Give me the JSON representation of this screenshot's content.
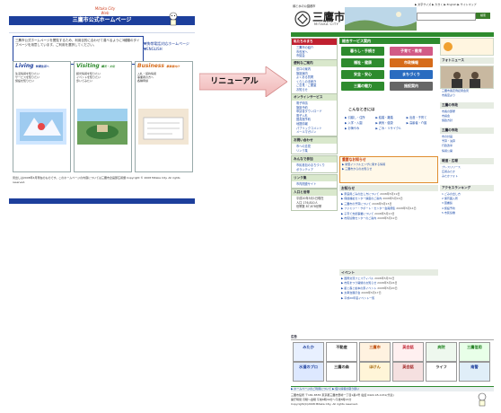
{
  "old_page": {
    "logo": "Mitaka City Web",
    "title": "三鷹市公式ホームページ",
    "intro": "三鷹市公式ホームページを閲覧するため、利用目的に合わせて達べるように3種類のタイプページを用意しています。ご利用を選択してください。",
    "links": [
      "▼携帯電話対応ホームページ",
      "▼ENGLISH"
    ],
    "columns": [
      {
        "title": "Living",
        "sub": "快適生活へ",
        "color": "#1d3f9c",
        "items": [
          "生活情報を知りたい",
          "サービスを知りたい",
          "施設を知りたい"
        ]
      },
      {
        "title": "Visiting",
        "sub": "観光・文化",
        "color": "#2e8b2e",
        "items": [
          "観光情報を知りたい",
          "イベントを知りたい",
          "歩いてみたい"
        ]
      },
      {
        "title": "Business",
        "sub": "事業者向け",
        "color": "#d66b1a",
        "items": [
          "入札・契約情報",
          "事業者の方へ",
          "各種申請"
        ]
      }
    ],
    "footer": "見出しは2008年4月現在のものです。このホームページの内容については三鷹市企画部広報課  Copyright © 2008 Mitaka City. All rights reserved."
  },
  "arrow": {
    "label": "リニューアル"
  },
  "new_page": {
    "tagline": "緑と水の公園都市",
    "city_name": "三鷹市",
    "city_en": "MITAKA CITY",
    "top_nav": "▶ 文字サイズ  ▶ 大きく  ▶ English  ▶ サイトマップ",
    "search_button": "検索",
    "left_boxes": [
      {
        "title": "私たちのまち",
        "style": "red",
        "items": [
          "三鷹市の紹介",
          "市長室へ",
          "市議会"
        ]
      },
      {
        "title": "便利なご案内",
        "style": "green",
        "items": [
          "窓口の案内",
          "施設案内",
          "よくある質問",
          "くらしの手続き",
          "ご意見・ご要望",
          "お知らせ"
        ]
      },
      {
        "title": "オンラインサービス",
        "style": "green",
        "items": [
          "電子申請",
          "施設予約",
          "申請書ダウンロード",
          "電子入札",
          "図書館予約",
          "地図情報",
          "パブリックコメント",
          "メールマガジン"
        ]
      },
      {
        "title": "お問い合わせ",
        "style": "green",
        "items": [
          "市への意見",
          "リンク集"
        ]
      },
      {
        "title": "みんなで参加",
        "style": "green",
        "items": [
          "市民参加のまちづくり",
          "ボランティア"
        ]
      },
      {
        "title": "リンク集",
        "style": "green",
        "items": [
          "市内関連サイト"
        ]
      },
      {
        "title": "人口と世帯",
        "style": "green",
        "items": [
          "平成20年5月1日現在",
          "人口 176,810人",
          "世帯数 87,678世帯"
        ]
      }
    ],
    "services_header": "総合サービス案内",
    "services": [
      {
        "label": "暮らし・手続き",
        "color": "#2e8b2e"
      },
      {
        "label": "子育て・教育",
        "color": "#d25a86"
      },
      {
        "label": "福祉・健康",
        "color": "#2e8b2e"
      },
      {
        "label": "市政情報",
        "color": "#d66b1a"
      },
      {
        "label": "安全・安心",
        "color": "#2e8b2e"
      },
      {
        "label": "まちづくり",
        "color": "#2a6cc0"
      },
      {
        "label": "三鷹の魅力",
        "color": "#2e8b2e"
      },
      {
        "label": "施設案内",
        "color": "#666"
      }
    ],
    "kotoba_head": "こんなときには",
    "kotoba_links": [
      "▶ 引越し・住所",
      "▶ 結婚・離婚",
      "▶ 出産・子育て",
      "▶ 入学・入園",
      "▶ 病気・健康",
      "▶ 高齢者・介護",
      "▶ お悔やみ",
      "▶ ごみ・リサイクル"
    ],
    "important_head": "重要なお知らせ",
    "important_items": [
      "▶ 新型インフルエンザに関する情報",
      "▶ 三鷹市からのお知らせ"
    ],
    "news_head": "お知らせ",
    "news_items": [
      {
        "text": "▶ 家庭用ごみの出し方について",
        "date": "2008年5月19日"
      },
      {
        "text": "▶ 保健福祉センター講座のご案内",
        "date": "2008年5月16日"
      },
      {
        "text": "▶ 三鷹市の予算について",
        "date": "2008年5月15日"
      },
      {
        "text": "▶ ファミリー・サポート・センター会員募集",
        "date": "2008年5月14日"
      },
      {
        "text": "▶ 子育て支援事業について",
        "date": "2008年5月13日"
      },
      {
        "text": "▶ 市民協働センターのご案内",
        "date": "2008年5月12日"
      }
    ],
    "event_head": "イベント",
    "event_items": [
      {
        "text": "▶ 国際交流フェスティバル",
        "date": "2008年5月31日"
      },
      {
        "text": "▶ 市民まつり開催のお知らせ",
        "date": "2008年5月24日"
      },
      {
        "text": "▶ 星と森と絵本の家イベント",
        "date": "2008年5月20日"
      },
      {
        "text": "▶ 太宰治展示会",
        "date": "2008年5月17日"
      },
      {
        "text": "▶ 平成20年度イベント一覧",
        "date": ""
      }
    ],
    "right_blocks": [
      {
        "title": "フォトニュース",
        "items": [
          "三鷹市長定例記者会見",
          "市長室より"
        ]
      },
      {
        "title": "三鷹の市政",
        "items": [
          "市長の部屋",
          "市議会",
          "施政方針"
        ]
      },
      {
        "title": "三鷹の市政",
        "items": [
          "市の計画",
          "予算・決算",
          "行政改革",
          "情報公開"
        ]
      },
      {
        "title": "報道・広報",
        "items": [
          "プレスリリース",
          "広報みたか",
          "みたかフォト"
        ]
      },
      {
        "title": "アクセスランキング",
        "items": [
          "1 ごみの出し方",
          "2 保育園入所",
          "3 図書館",
          "4 施設予約",
          "5 市民協働"
        ]
      }
    ],
    "ads_head": "広告",
    "ads": [
      {
        "label": "みたか",
        "bg": "#e8f0ff",
        "fg": "#1d3f9c"
      },
      {
        "label": "不動産",
        "bg": "#ffffff",
        "fg": "#333333"
      },
      {
        "label": "三鷹市",
        "bg": "#fff2e0",
        "fg": "#c05010"
      },
      {
        "label": "英会話",
        "bg": "#fff0f0",
        "fg": "#c02030"
      },
      {
        "label": "病院",
        "bg": "#eef8ee",
        "fg": "#2e8b2e"
      },
      {
        "label": "三鷹信用",
        "bg": "#e8ffe8",
        "fg": "#1a7a1a"
      },
      {
        "label": "水道のプロ",
        "bg": "#dde8ff",
        "fg": "#1d3f9c"
      },
      {
        "label": "三鷹の森",
        "bg": "#ffffff",
        "fg": "#333333"
      },
      {
        "label": "ほけん",
        "bg": "#fff5d8",
        "fg": "#a06000"
      },
      {
        "label": "英会話",
        "bg": "#f5e0e0",
        "fg": "#a02020"
      },
      {
        "label": "ライフ",
        "bg": "#ffffff",
        "fg": "#333333"
      },
      {
        "label": "南警",
        "bg": "#e0eef8",
        "fg": "#1d3f9c"
      }
    ],
    "footer_links": "▶ ホームページのご利用について  ▶ 個人情報の取り扱い",
    "footer_address": "三鷹市役所 〒181-8555 東京都三鷹市野崎一丁目1番1号 電話 0422-45-1151(代表)",
    "footer_hours": "開庁時間 月曜～金曜 午前8時30分～午後5時15分",
    "copyright": "Copyright(C)2008 Mitaka City, All rights reserved."
  }
}
